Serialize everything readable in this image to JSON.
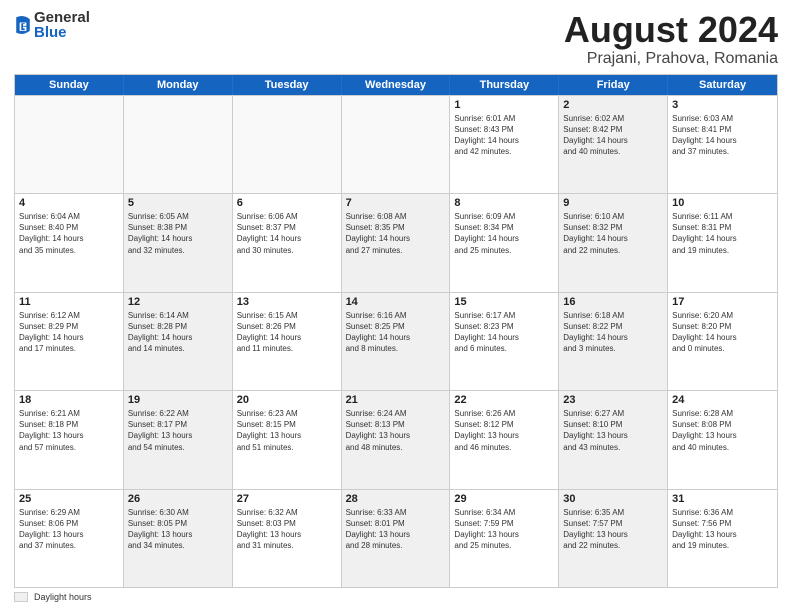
{
  "header": {
    "logo_general": "General",
    "logo_blue": "Blue",
    "title": "August 2024",
    "subtitle": "Prajani, Prahova, Romania"
  },
  "days_of_week": [
    "Sunday",
    "Monday",
    "Tuesday",
    "Wednesday",
    "Thursday",
    "Friday",
    "Saturday"
  ],
  "footer_label": "Daylight hours",
  "weeks": [
    [
      {
        "day": "",
        "info": "",
        "shaded": false,
        "empty": true
      },
      {
        "day": "",
        "info": "",
        "shaded": false,
        "empty": true
      },
      {
        "day": "",
        "info": "",
        "shaded": false,
        "empty": true
      },
      {
        "day": "",
        "info": "",
        "shaded": false,
        "empty": true
      },
      {
        "day": "1",
        "info": "Sunrise: 6:01 AM\nSunset: 8:43 PM\nDaylight: 14 hours\nand 42 minutes.",
        "shaded": false,
        "empty": false
      },
      {
        "day": "2",
        "info": "Sunrise: 6:02 AM\nSunset: 8:42 PM\nDaylight: 14 hours\nand 40 minutes.",
        "shaded": true,
        "empty": false
      },
      {
        "day": "3",
        "info": "Sunrise: 6:03 AM\nSunset: 8:41 PM\nDaylight: 14 hours\nand 37 minutes.",
        "shaded": false,
        "empty": false
      }
    ],
    [
      {
        "day": "4",
        "info": "Sunrise: 6:04 AM\nSunset: 8:40 PM\nDaylight: 14 hours\nand 35 minutes.",
        "shaded": false,
        "empty": false
      },
      {
        "day": "5",
        "info": "Sunrise: 6:05 AM\nSunset: 8:38 PM\nDaylight: 14 hours\nand 32 minutes.",
        "shaded": true,
        "empty": false
      },
      {
        "day": "6",
        "info": "Sunrise: 6:06 AM\nSunset: 8:37 PM\nDaylight: 14 hours\nand 30 minutes.",
        "shaded": false,
        "empty": false
      },
      {
        "day": "7",
        "info": "Sunrise: 6:08 AM\nSunset: 8:35 PM\nDaylight: 14 hours\nand 27 minutes.",
        "shaded": true,
        "empty": false
      },
      {
        "day": "8",
        "info": "Sunrise: 6:09 AM\nSunset: 8:34 PM\nDaylight: 14 hours\nand 25 minutes.",
        "shaded": false,
        "empty": false
      },
      {
        "day": "9",
        "info": "Sunrise: 6:10 AM\nSunset: 8:32 PM\nDaylight: 14 hours\nand 22 minutes.",
        "shaded": true,
        "empty": false
      },
      {
        "day": "10",
        "info": "Sunrise: 6:11 AM\nSunset: 8:31 PM\nDaylight: 14 hours\nand 19 minutes.",
        "shaded": false,
        "empty": false
      }
    ],
    [
      {
        "day": "11",
        "info": "Sunrise: 6:12 AM\nSunset: 8:29 PM\nDaylight: 14 hours\nand 17 minutes.",
        "shaded": false,
        "empty": false
      },
      {
        "day": "12",
        "info": "Sunrise: 6:14 AM\nSunset: 8:28 PM\nDaylight: 14 hours\nand 14 minutes.",
        "shaded": true,
        "empty": false
      },
      {
        "day": "13",
        "info": "Sunrise: 6:15 AM\nSunset: 8:26 PM\nDaylight: 14 hours\nand 11 minutes.",
        "shaded": false,
        "empty": false
      },
      {
        "day": "14",
        "info": "Sunrise: 6:16 AM\nSunset: 8:25 PM\nDaylight: 14 hours\nand 8 minutes.",
        "shaded": true,
        "empty": false
      },
      {
        "day": "15",
        "info": "Sunrise: 6:17 AM\nSunset: 8:23 PM\nDaylight: 14 hours\nand 6 minutes.",
        "shaded": false,
        "empty": false
      },
      {
        "day": "16",
        "info": "Sunrise: 6:18 AM\nSunset: 8:22 PM\nDaylight: 14 hours\nand 3 minutes.",
        "shaded": true,
        "empty": false
      },
      {
        "day": "17",
        "info": "Sunrise: 6:20 AM\nSunset: 8:20 PM\nDaylight: 14 hours\nand 0 minutes.",
        "shaded": false,
        "empty": false
      }
    ],
    [
      {
        "day": "18",
        "info": "Sunrise: 6:21 AM\nSunset: 8:18 PM\nDaylight: 13 hours\nand 57 minutes.",
        "shaded": false,
        "empty": false
      },
      {
        "day": "19",
        "info": "Sunrise: 6:22 AM\nSunset: 8:17 PM\nDaylight: 13 hours\nand 54 minutes.",
        "shaded": true,
        "empty": false
      },
      {
        "day": "20",
        "info": "Sunrise: 6:23 AM\nSunset: 8:15 PM\nDaylight: 13 hours\nand 51 minutes.",
        "shaded": false,
        "empty": false
      },
      {
        "day": "21",
        "info": "Sunrise: 6:24 AM\nSunset: 8:13 PM\nDaylight: 13 hours\nand 48 minutes.",
        "shaded": true,
        "empty": false
      },
      {
        "day": "22",
        "info": "Sunrise: 6:26 AM\nSunset: 8:12 PM\nDaylight: 13 hours\nand 46 minutes.",
        "shaded": false,
        "empty": false
      },
      {
        "day": "23",
        "info": "Sunrise: 6:27 AM\nSunset: 8:10 PM\nDaylight: 13 hours\nand 43 minutes.",
        "shaded": true,
        "empty": false
      },
      {
        "day": "24",
        "info": "Sunrise: 6:28 AM\nSunset: 8:08 PM\nDaylight: 13 hours\nand 40 minutes.",
        "shaded": false,
        "empty": false
      }
    ],
    [
      {
        "day": "25",
        "info": "Sunrise: 6:29 AM\nSunset: 8:06 PM\nDaylight: 13 hours\nand 37 minutes.",
        "shaded": false,
        "empty": false
      },
      {
        "day": "26",
        "info": "Sunrise: 6:30 AM\nSunset: 8:05 PM\nDaylight: 13 hours\nand 34 minutes.",
        "shaded": true,
        "empty": false
      },
      {
        "day": "27",
        "info": "Sunrise: 6:32 AM\nSunset: 8:03 PM\nDaylight: 13 hours\nand 31 minutes.",
        "shaded": false,
        "empty": false
      },
      {
        "day": "28",
        "info": "Sunrise: 6:33 AM\nSunset: 8:01 PM\nDaylight: 13 hours\nand 28 minutes.",
        "shaded": true,
        "empty": false
      },
      {
        "day": "29",
        "info": "Sunrise: 6:34 AM\nSunset: 7:59 PM\nDaylight: 13 hours\nand 25 minutes.",
        "shaded": false,
        "empty": false
      },
      {
        "day": "30",
        "info": "Sunrise: 6:35 AM\nSunset: 7:57 PM\nDaylight: 13 hours\nand 22 minutes.",
        "shaded": true,
        "empty": false
      },
      {
        "day": "31",
        "info": "Sunrise: 6:36 AM\nSunset: 7:56 PM\nDaylight: 13 hours\nand 19 minutes.",
        "shaded": false,
        "empty": false
      }
    ]
  ]
}
